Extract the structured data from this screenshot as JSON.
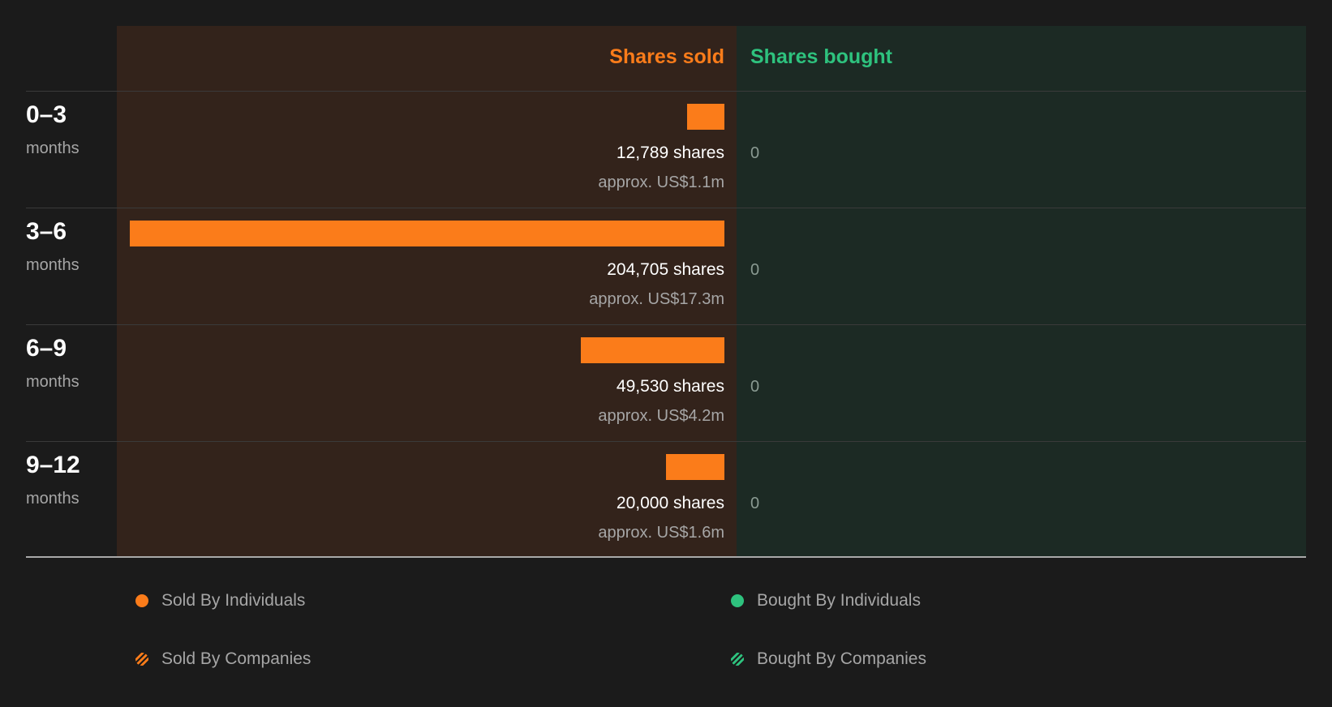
{
  "headers": {
    "sold": "Shares sold",
    "bought": "Shares bought"
  },
  "colors": {
    "sold": "#fb7c1a",
    "bought": "#2ec27e",
    "sold_bg": "#33231b",
    "bought_bg": "#1c2a24"
  },
  "chart_data": {
    "type": "bar",
    "orientation": "horizontal",
    "categories": [
      "0-3",
      "3-6",
      "6-9",
      "9-12"
    ],
    "series": [
      {
        "name": "Shares sold",
        "values": [
          12789,
          204705,
          49530,
          20000
        ]
      },
      {
        "name": "Shares bought",
        "values": [
          0,
          0,
          0,
          0
        ]
      }
    ],
    "grid": false,
    "legend_position": "bottom"
  },
  "rows": [
    {
      "period": "0–3",
      "unit": "months",
      "sold_shares": "12,789 shares",
      "sold_value": "approx. US$1.1m",
      "bought": "0"
    },
    {
      "period": "3–6",
      "unit": "months",
      "sold_shares": "204,705 shares",
      "sold_value": "approx. US$17.3m",
      "bought": "0"
    },
    {
      "period": "6–9",
      "unit": "months",
      "sold_shares": "49,530 shares",
      "sold_value": "approx. US$4.2m",
      "bought": "0"
    },
    {
      "period": "9–12",
      "unit": "months",
      "sold_shares": "20,000 shares",
      "sold_value": "approx. US$1.6m",
      "bought": "0"
    }
  ],
  "legend": [
    {
      "label": "Sold By Individuals",
      "icon": "solid-dot-icon",
      "color": "#fb7c1a"
    },
    {
      "label": "Bought By Individuals",
      "icon": "solid-dot-icon",
      "color": "#2ec27e"
    },
    {
      "label": "Sold By Companies",
      "icon": "striped-dot-icon",
      "color": "#fb7c1a"
    },
    {
      "label": "Bought By Companies",
      "icon": "striped-dot-icon",
      "color": "#2ec27e"
    }
  ]
}
